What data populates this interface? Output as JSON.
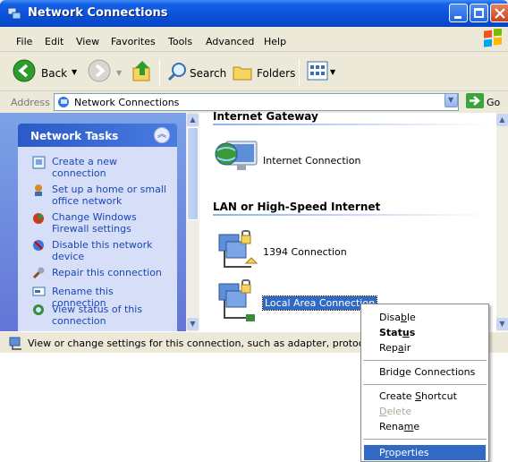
{
  "window": {
    "title": "Network Connections"
  },
  "menubar": [
    "File",
    "Edit",
    "View",
    "Favorites",
    "Tools",
    "Advanced",
    "Help"
  ],
  "toolbar": {
    "back": "Back",
    "search": "Search",
    "folders": "Folders"
  },
  "address": {
    "label": "Address",
    "value": "Network Connections",
    "go": "Go"
  },
  "tasks": {
    "title": "Network Tasks",
    "items": [
      {
        "label": "Create a new connection",
        "icon": "new-connection-icon"
      },
      {
        "label": "Set up a home or small office network",
        "icon": "home-network-icon"
      },
      {
        "label": "Change Windows Firewall settings",
        "icon": "firewall-icon"
      },
      {
        "label": "Disable this network device",
        "icon": "disable-device-icon"
      },
      {
        "label": "Repair this connection",
        "icon": "repair-icon"
      },
      {
        "label": "Rename this connection",
        "icon": "rename-icon"
      },
      {
        "label": "View status of this connection",
        "icon": "status-icon"
      }
    ]
  },
  "main": {
    "groups": [
      {
        "title": "Internet Gateway",
        "items": [
          "Internet Connection"
        ]
      },
      {
        "title": "LAN or High-Speed Internet",
        "items": [
          "1394 Connection",
          "Local Area Connection"
        ]
      }
    ]
  },
  "status": {
    "text": "View or change settings for this connection, such as adapter, protocol, or m"
  },
  "context_menu": {
    "items": [
      {
        "pre": "Disa",
        "acc": "b",
        "post": "le",
        "state": "normal"
      },
      {
        "pre": "Stat",
        "acc": "u",
        "post": "s",
        "state": "bold"
      },
      {
        "pre": "Rep",
        "acc": "a",
        "post": "ir",
        "state": "normal"
      },
      {
        "pre": "Brid",
        "acc": "g",
        "post": "e Connections",
        "state": "normal"
      },
      {
        "pre": "Create ",
        "acc": "S",
        "post": "hortcut",
        "state": "normal"
      },
      {
        "pre": "",
        "acc": "D",
        "post": "elete",
        "state": "disabled"
      },
      {
        "pre": "Rena",
        "acc": "m",
        "post": "e",
        "state": "normal"
      },
      {
        "pre": "P",
        "acc": "r",
        "post": "operties",
        "state": "highlighted"
      }
    ]
  },
  "colors": {
    "titlebar": "#0a50d8",
    "selection": "#316ac5",
    "task_link": "#1a46b8"
  }
}
